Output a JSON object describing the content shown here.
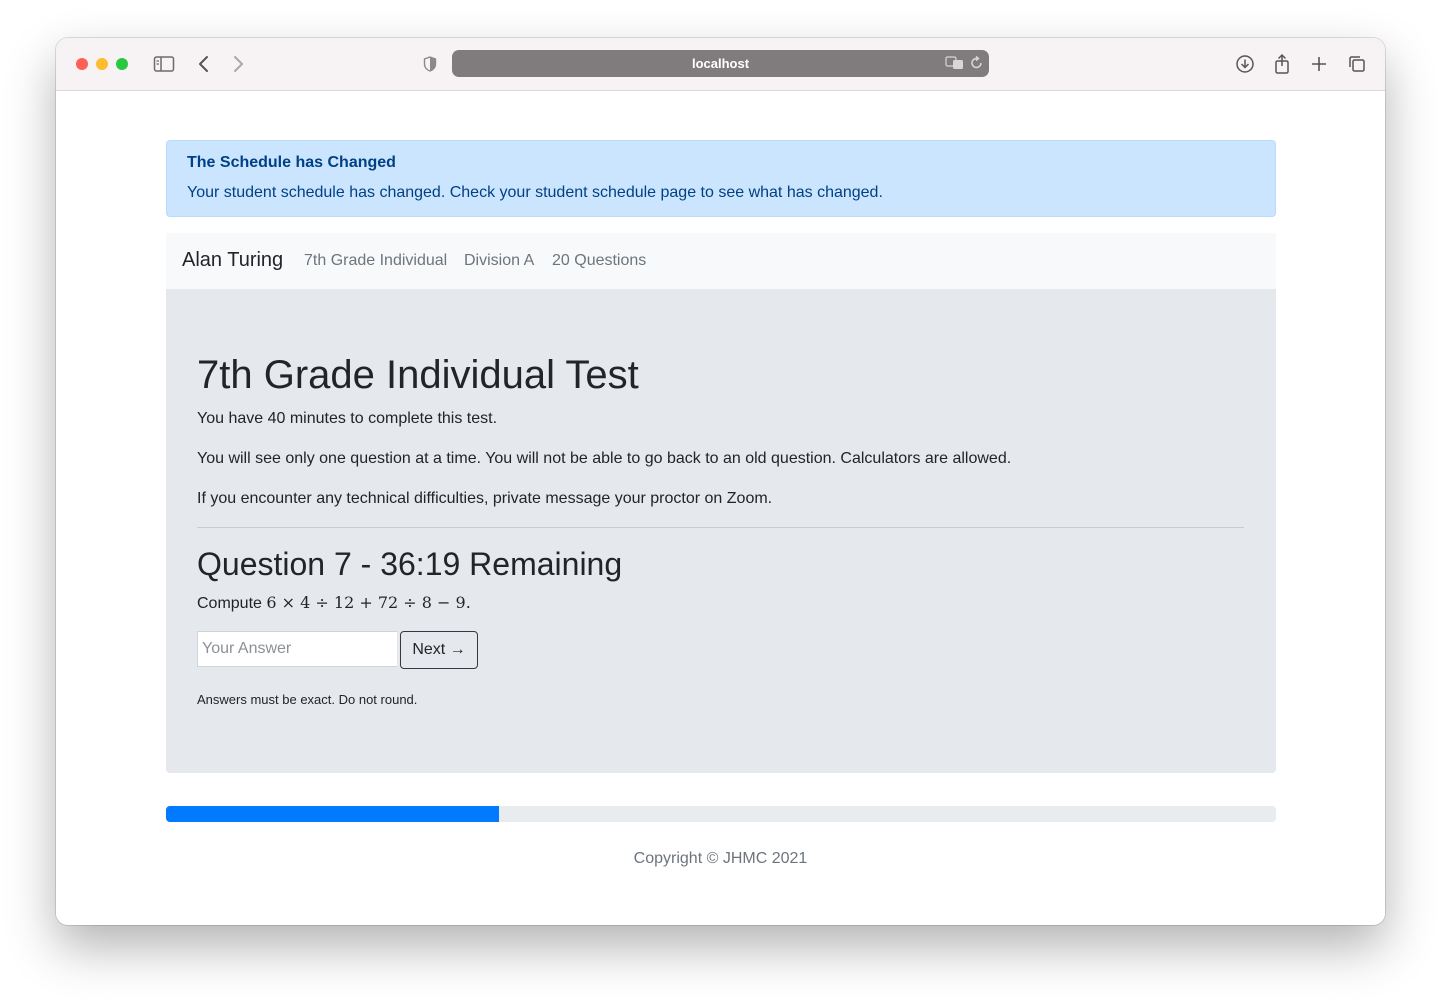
{
  "browser": {
    "url": "localhost"
  },
  "alert": {
    "title": "The Schedule has Changed",
    "body": "Your student schedule has changed. Check your student schedule page to see what has changed."
  },
  "navbar": {
    "brand": "Alan Turing",
    "links": [
      "7th Grade Individual",
      "Division A",
      "20 Questions"
    ]
  },
  "test": {
    "title": "7th Grade Individual Test",
    "instructions": [
      "You have 40 minutes to complete this test.",
      "You will see only one question at a time. You will not be able to go back to an old question. Calculators are allowed.",
      "If you encounter any technical difficulties, private message your proctor on Zoom."
    ],
    "question_heading": "Question 7 - 36:19 Remaining",
    "question_prefix": "Compute",
    "question_math": "6 × 4 ÷ 12 + 72 ÷ 8 − 9",
    "question_suffix": ".",
    "answer_placeholder": "Your Answer",
    "next_label": "Next →",
    "help_text": "Answers must be exact. Do not round."
  },
  "progress": {
    "value": 0.3
  },
  "footer": {
    "text": "Copyright © JHMC 2021"
  },
  "colors": {
    "alert_bg": "#cce5ff",
    "alert_text": "#004085",
    "progress_fill": "#007bff",
    "jumbotron_bg": "#e5e8ec"
  }
}
